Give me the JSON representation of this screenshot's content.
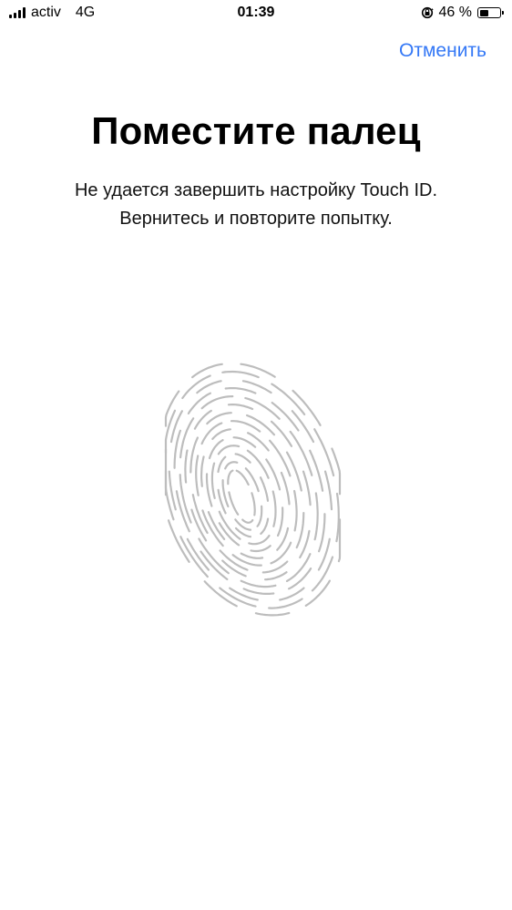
{
  "status_bar": {
    "carrier": "activ",
    "network": "4G",
    "time": "01:39",
    "battery_percent": "46 %",
    "battery_level": 0.46,
    "signal_bars": 4,
    "rotation_lock_icon": "rotation-lock-icon"
  },
  "nav": {
    "cancel_label": "Отменить"
  },
  "main": {
    "title": "Поместите палец",
    "subtitle_line1": "Не удается завершить настройку Touch ID.",
    "subtitle_line2": "Вернитесь и повторите попытку.",
    "fingerprint_icon": "fingerprint-icon"
  },
  "colors": {
    "accent": "#3478f6",
    "fingerprint": "#bdbdbd",
    "background": "#ffffff"
  }
}
